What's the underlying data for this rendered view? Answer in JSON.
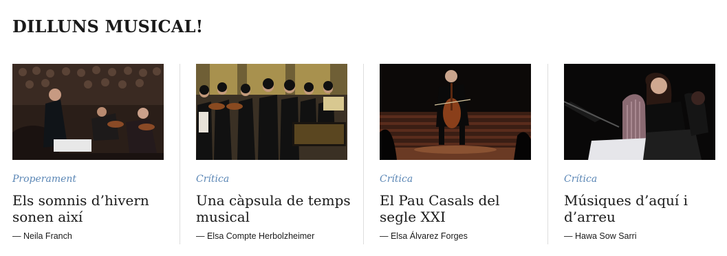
{
  "section": {
    "title": "DILLUNS MUSICAL!"
  },
  "cards": [
    {
      "category": "Properament",
      "headline": "Els somnis d’hivern sonen així",
      "author": "— Neila Franch",
      "image": "orchestra-conductor-photo"
    },
    {
      "category": "Crítica",
      "headline": "Una càpsula de temps musical",
      "author": "— Elsa Compte Herbolzheimer",
      "image": "baroque-ensemble-photo"
    },
    {
      "category": "Crítica",
      "headline": "El Pau Casals del segle XXI",
      "author": "— Elsa Álvarez Forges",
      "image": "solo-cellist-photo"
    },
    {
      "category": "Crítica",
      "headline": "Músiques d’aquí i d’arreu",
      "author": "— Hawa Sow Sarri",
      "image": "harpist-performer-photo"
    }
  ],
  "colors": {
    "category": "#5a86b5",
    "text": "#1a1a1a",
    "divider": "#dddddd"
  }
}
